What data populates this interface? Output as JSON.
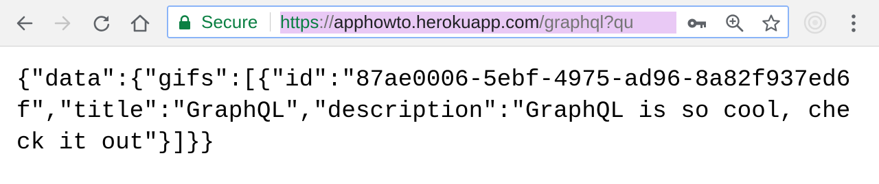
{
  "browser": {
    "security_label": "Secure",
    "url": {
      "scheme": "https",
      "separator": "://",
      "host": "apphowto.herokuapp.com",
      "path": "/graphql?qu"
    },
    "colors": {
      "secure_green": "#0b8043",
      "url_highlight": "#e9c9f5",
      "focus_ring": "#8ab4f8",
      "toolbar_bg": "#f2f2f2"
    },
    "icons": {
      "back": "arrow-left-icon",
      "forward": "arrow-right-icon",
      "reload": "reload-icon",
      "home": "home-icon",
      "lock": "lock-icon",
      "key": "key-icon",
      "zoom": "zoom-in-icon",
      "bookmark": "star-icon",
      "extension": "extension-icon",
      "menu": "kebab-menu-icon"
    }
  },
  "page": {
    "body_text": "{\"data\":{\"gifs\":[{\"id\":\"87ae0006-5ebf-4975-ad96-8a82f937ed6f\",\"title\":\"GraphQL\",\"description\":\"GraphQL is so cool, check it out\"}]}}"
  }
}
